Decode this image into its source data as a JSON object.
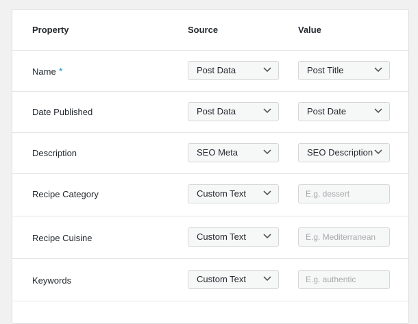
{
  "header": {
    "property": "Property",
    "source": "Source",
    "value": "Value"
  },
  "rows": [
    {
      "property": "Name",
      "required_mark": "*",
      "source": "Post Data",
      "value_select": "Post Title"
    },
    {
      "property": "Date Published",
      "source": "Post Data",
      "value_select": "Post Date"
    },
    {
      "property": "Description",
      "source": "SEO Meta",
      "value_select": "SEO Description"
    },
    {
      "property": "Recipe Category",
      "source": "Custom Text",
      "value_placeholder": "E.g. dessert"
    },
    {
      "property": "Recipe Cuisine",
      "source": "Custom Text",
      "value_placeholder": "E.g. Mediterranean"
    },
    {
      "property": "Keywords",
      "source": "Custom Text",
      "value_placeholder": "E.g. authentic"
    }
  ],
  "icons": {
    "dropdown": "chevron-down-icon",
    "required": "asterisk"
  }
}
